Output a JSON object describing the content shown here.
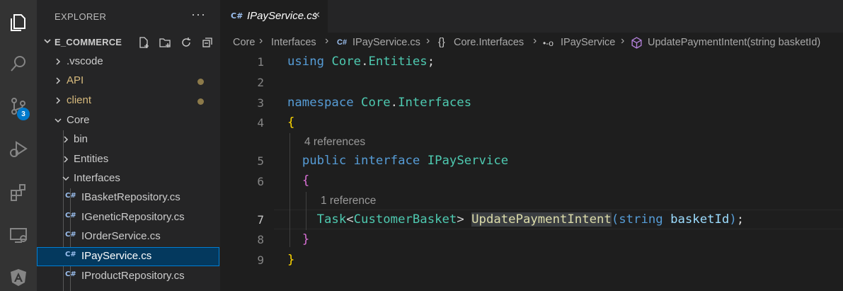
{
  "activity_bar": {
    "items": [
      {
        "name": "explorer-icon"
      },
      {
        "name": "search-icon"
      },
      {
        "name": "source-control-icon",
        "badge": "3"
      },
      {
        "name": "run-debug-icon"
      },
      {
        "name": "extensions-icon"
      },
      {
        "name": "remote-explorer-icon"
      },
      {
        "name": "angular-icon"
      }
    ]
  },
  "sidebar": {
    "title": "EXPLORER",
    "more": "···",
    "section": "E_COMMERCE",
    "tree": [
      {
        "label": ".vscode",
        "kind": "folder",
        "color": "#cccccc"
      },
      {
        "label": "API",
        "kind": "folder",
        "color": "#d7ba7d",
        "modified": true
      },
      {
        "label": "client",
        "kind": "folder",
        "color": "#d7ba7d",
        "modified": true
      },
      {
        "label": "Core",
        "kind": "folder-open"
      },
      {
        "label": "bin",
        "kind": "folder"
      },
      {
        "label": "Entities",
        "kind": "folder"
      },
      {
        "label": "Interfaces",
        "kind": "folder-open"
      },
      {
        "label": "IBasketRepository.cs",
        "kind": "file",
        "icon": "C#"
      },
      {
        "label": "IGeneticRepository.cs",
        "kind": "file",
        "icon": "C#"
      },
      {
        "label": "IOrderService.cs",
        "kind": "file",
        "icon": "C#"
      },
      {
        "label": "IPayService.cs",
        "kind": "file",
        "icon": "C#",
        "selected": true
      },
      {
        "label": "IProductRepository.cs",
        "kind": "file",
        "icon": "C#"
      }
    ]
  },
  "editor": {
    "tab": {
      "icon": "C#",
      "label": "IPayService.cs",
      "close": "×"
    },
    "breadcrumb": {
      "items": [
        "Core",
        "Interfaces",
        "IPayService.cs",
        "Core.Interfaces",
        "IPayService",
        "UpdatePaymentIntent(string basketId)"
      ],
      "icons": {
        "file": "C#",
        "namespace": "{}",
        "interface": "•-o"
      }
    },
    "line_numbers": [
      "1",
      "2",
      "3",
      "4",
      "5",
      "6",
      "7",
      "8",
      "9"
    ],
    "codelens": [
      "4 references",
      "1 reference"
    ],
    "code": {
      "l1": {
        "kw": "using",
        "ns1": "Core",
        "dot": ".",
        "ns2": "Entities",
        "semi": ";"
      },
      "l3": {
        "kw": "namespace",
        "ns1": "Core",
        "dot": ".",
        "ns2": "Interfaces"
      },
      "l4": {
        "brace": "{"
      },
      "l5": {
        "kw1": "public",
        "kw2": "interface",
        "name": "IPayService"
      },
      "l6": {
        "brace": "{"
      },
      "l7": {
        "type": "Task",
        "lt": "<",
        "generic": "CustomerBasket",
        "gt": ">",
        "method": "UpdatePaymentIntent",
        "open": "(",
        "ptype": "string",
        "pname": "basketId",
        "close": ")",
        "semi": ";"
      },
      "l8": {
        "brace": "}"
      },
      "l9": {
        "brace": "}"
      }
    }
  }
}
